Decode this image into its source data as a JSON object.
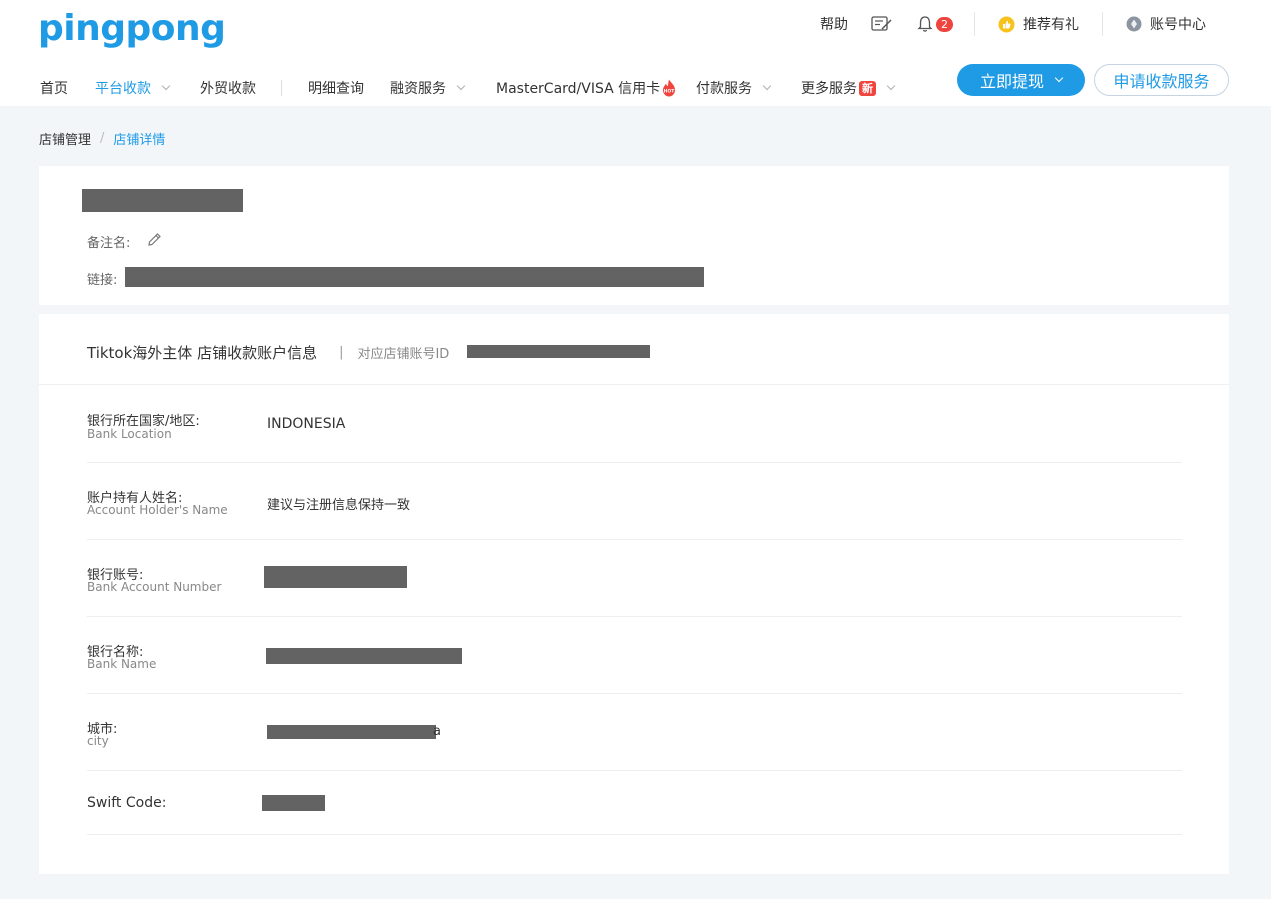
{
  "header": {
    "logo": "pingpong",
    "help": "帮助",
    "notification_count": "2",
    "referral": "推荐有礼",
    "account_center": "账号中心"
  },
  "nav": {
    "items": [
      {
        "label": "首页"
      },
      {
        "label": "平台收款"
      },
      {
        "label": "外贸收款"
      },
      {
        "label": "明细查询"
      },
      {
        "label": "融资服务"
      },
      {
        "label": "MasterCard/VISA 信用卡"
      },
      {
        "label": "付款服务"
      },
      {
        "label": "更多服务"
      }
    ],
    "hot_badge": "HOT",
    "new_badge": "新",
    "withdraw_button": "立即提现",
    "apply_button": "申请收款服务"
  },
  "breadcrumb": {
    "parent": "店铺管理",
    "separator": "/",
    "current": "店铺详情"
  },
  "store": {
    "remark_label": "备注名:",
    "link_label": "链接:"
  },
  "account": {
    "title": "Tiktok海外主体 店铺收款账户信息",
    "divider": "|",
    "store_id_label": "对应店铺账号ID",
    "rows": [
      {
        "cn": "银行所在国家/地区:",
        "en": "Bank Location",
        "value": "INDONESIA"
      },
      {
        "cn": "账户持有人姓名:",
        "en": "Account Holder's Name",
        "value": "建议与注册信息保持一致"
      },
      {
        "cn": "银行账号:",
        "en": "Bank Account Number",
        "value": ""
      },
      {
        "cn": "银行名称:",
        "en": "Bank Name",
        "value": ""
      },
      {
        "cn": "城市:",
        "en": "city",
        "value": "a"
      },
      {
        "cn": "Swift Code:",
        "en": "",
        "value": ""
      }
    ]
  },
  "colors": {
    "brand": "#1f9be5",
    "badge_red": "#f0443e",
    "redaction": "#636363"
  }
}
